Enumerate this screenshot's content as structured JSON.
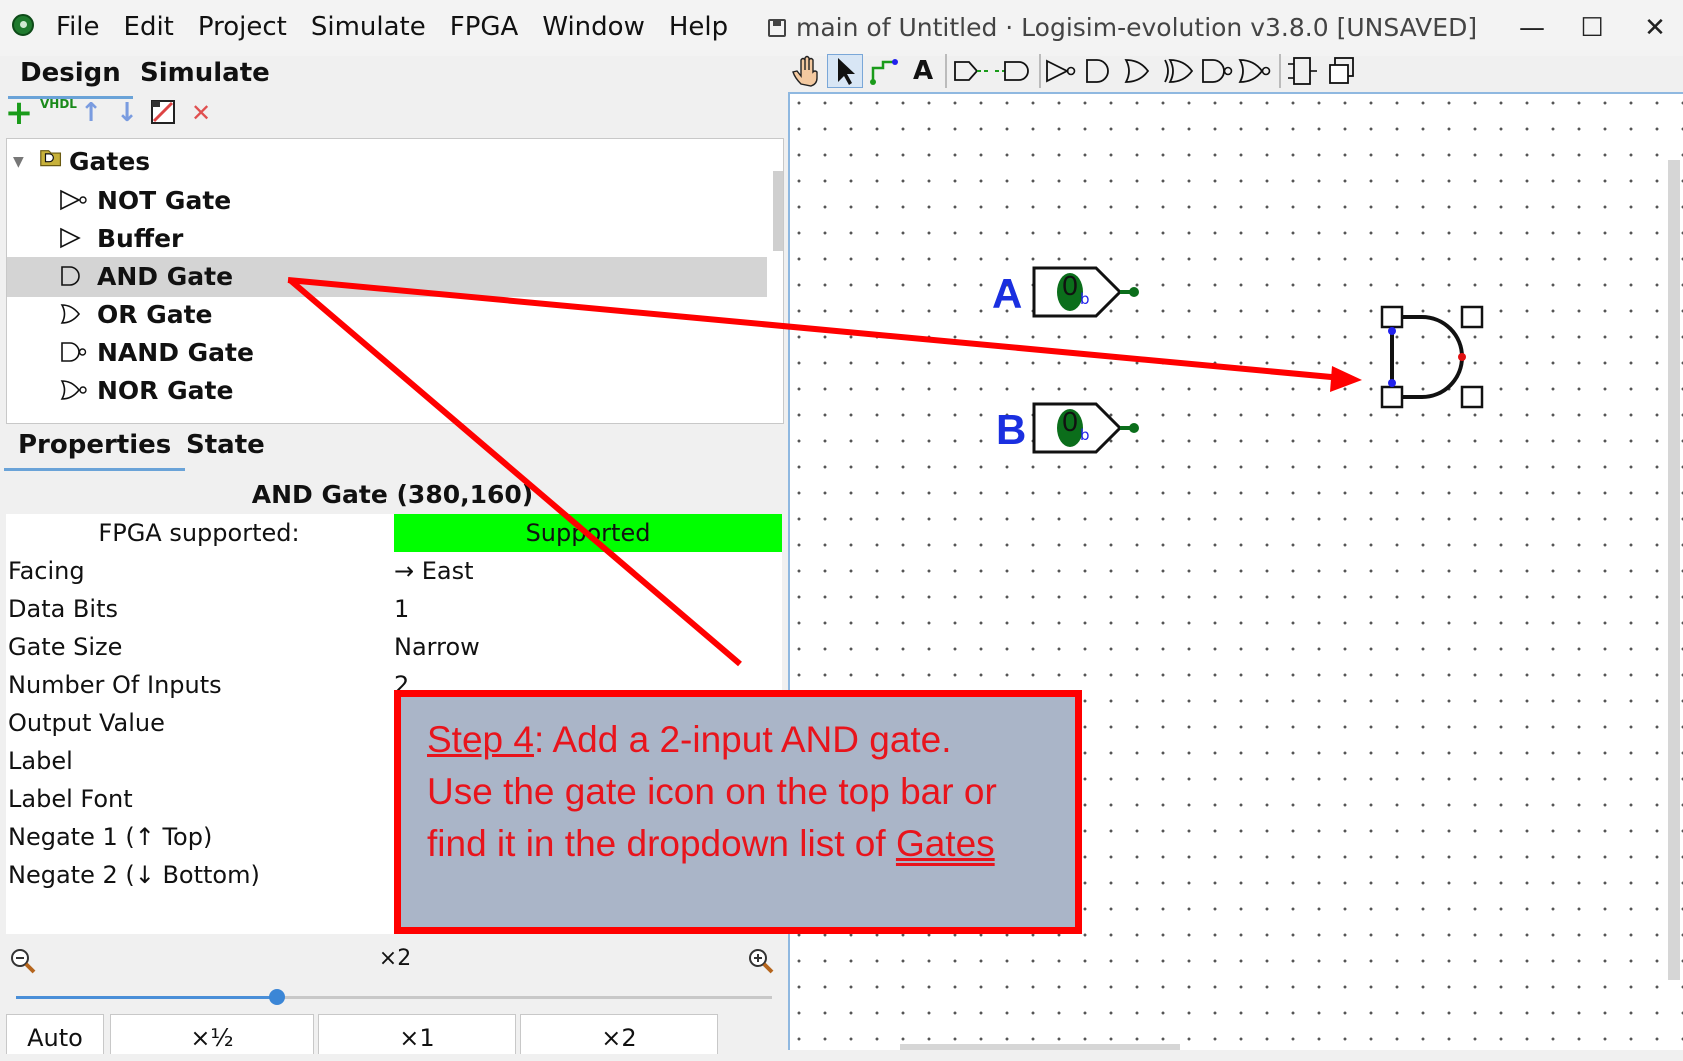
{
  "window": {
    "title": "main of Untitled · Logisim-evolution v3.8.0 [UNSAVED]",
    "minimize": "—",
    "maximize": "☐",
    "close": "✕"
  },
  "menu": [
    "File",
    "Edit",
    "Project",
    "Simulate",
    "FPGA",
    "Window",
    "Help"
  ],
  "top_tabs": {
    "design": "Design",
    "simulate": "Simulate"
  },
  "left_toolbar": {
    "add": "+",
    "vhdl": "VHDL",
    "up": "↑",
    "down": "↓",
    "remove": "✕"
  },
  "tree": {
    "folder": "Gates",
    "items": [
      {
        "label": "NOT Gate",
        "icon": "not-gate-icon"
      },
      {
        "label": "Buffer",
        "icon": "buffer-icon"
      },
      {
        "label": "AND Gate",
        "icon": "and-gate-icon",
        "selected": true
      },
      {
        "label": "OR Gate",
        "icon": "or-gate-icon"
      },
      {
        "label": "NAND Gate",
        "icon": "nand-gate-icon"
      },
      {
        "label": "NOR Gate",
        "icon": "nor-gate-icon"
      }
    ]
  },
  "props_tabs": {
    "properties": "Properties",
    "state": "State"
  },
  "properties": {
    "title": "AND Gate (380,160)",
    "fpga_label": "FPGA supported:",
    "fpga_value": "Supported",
    "rows": [
      {
        "name": "Facing",
        "value": "→ East"
      },
      {
        "name": "Data Bits",
        "value": "1"
      },
      {
        "name": "Gate Size",
        "value": "Narrow"
      },
      {
        "name": "Number Of Inputs",
        "value": "2"
      },
      {
        "name": "Output Value",
        "value": ""
      },
      {
        "name": "Label",
        "value": ""
      },
      {
        "name": "Label Font",
        "value": ""
      },
      {
        "name": "Negate 1 (↑ Top)",
        "value": ""
      },
      {
        "name": "Negate 2 (↓ Bottom)",
        "value": ""
      }
    ]
  },
  "zoom": {
    "level_label": "×2",
    "slider_value": 0.5,
    "buttons": [
      "Auto",
      "×½",
      "×1",
      "×2"
    ]
  },
  "canvas": {
    "pins": [
      {
        "label": "A",
        "value": "0",
        "radix": "b"
      },
      {
        "label": "B",
        "value": "0",
        "radix": "b"
      }
    ]
  },
  "annotation": {
    "step": "Step 4",
    "line1_rest": ":  Add a 2-input AND gate.",
    "line2": "Use the gate icon on the top bar or",
    "line3_prefix": "find it in the dropdown list of ",
    "line3_link": "Gates"
  },
  "colors": {
    "accent_red": "#ff0000",
    "callout_bg": "#aab5c8",
    "fpga_green": "#00ff00",
    "pin_label_blue": "#1a2fe0",
    "pin_value_green": "#0b6e1b"
  }
}
